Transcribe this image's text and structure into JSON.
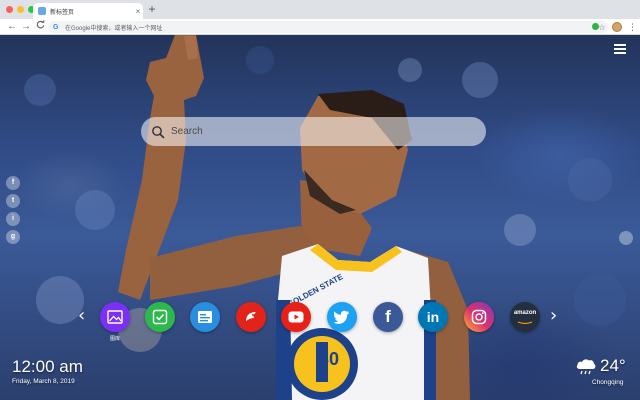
{
  "browser": {
    "tab_title": "新标签页",
    "tab_close": "×",
    "new_tab": "+",
    "omnibox_placeholder": "在Google中搜索，或者输入一个网址",
    "nav": {
      "back": "←",
      "forward": "→",
      "reload": "C"
    }
  },
  "search": {
    "placeholder": "Search"
  },
  "social": [
    "f",
    "t",
    "i",
    "g"
  ],
  "apps": [
    {
      "icon": "image-app-icon",
      "color": "#7b2ff7",
      "label": "图库"
    },
    {
      "icon": "check-app-icon",
      "color": "#2db84d",
      "label": ""
    },
    {
      "icon": "notes-app-icon",
      "color": "#2a8ee0",
      "label": ""
    },
    {
      "icon": "game-app-icon",
      "color": "#e2231a",
      "label": ""
    },
    {
      "icon": "youtube-icon",
      "color": "#e62117",
      "label": ""
    },
    {
      "icon": "twitter-icon",
      "color": "#1da1f2",
      "label": ""
    },
    {
      "icon": "facebook-icon",
      "color": "#3b5998",
      "label": ""
    },
    {
      "icon": "linkedin-icon",
      "color": "#0077b5",
      "label": ""
    },
    {
      "icon": "instagram-icon",
      "color": "#d6249f",
      "label": ""
    },
    {
      "icon": "amazon-icon",
      "color": "#232f3e",
      "label": ""
    }
  ],
  "amazon_text": "amazon",
  "clock": {
    "time": "12:00 am",
    "date": "Friday, March 8, 2019"
  },
  "weather": {
    "temperature": "24°",
    "city": "Chongqing"
  },
  "jersey": {
    "text": "GOLDEN STATE",
    "number": "30"
  }
}
